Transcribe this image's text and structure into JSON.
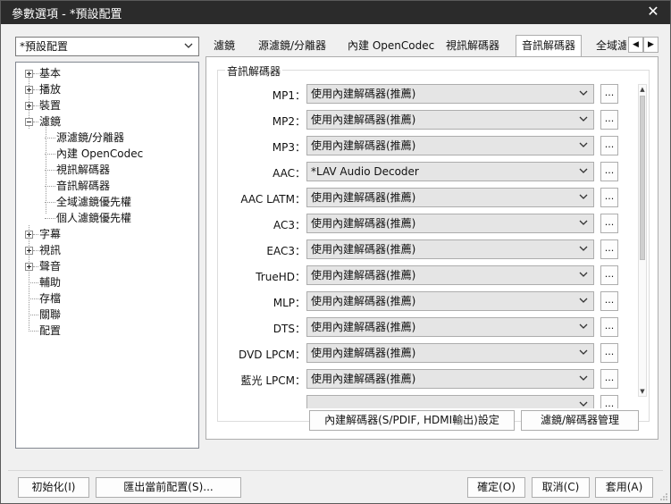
{
  "window": {
    "title": "參數選項 - *預設配置",
    "close_glyph": "✕"
  },
  "profile": {
    "selected": "*預設配置"
  },
  "tree": [
    {
      "label": "基本",
      "expandable": true
    },
    {
      "label": "播放",
      "expandable": true
    },
    {
      "label": "裝置",
      "expandable": true
    },
    {
      "label": "濾鏡",
      "expandable": true,
      "expanded": true,
      "children": [
        "源濾鏡/分離器",
        "內建 OpenCodec",
        "視訊解碼器",
        "音訊解碼器",
        "全域濾鏡優先權",
        "個人濾鏡優先權"
      ]
    },
    {
      "label": "字幕",
      "expandable": true
    },
    {
      "label": "視訊",
      "expandable": true
    },
    {
      "label": "聲音",
      "expandable": true
    },
    {
      "label": "輔助",
      "expandable": false
    },
    {
      "label": "存檔",
      "expandable": false
    },
    {
      "label": "關聯",
      "expandable": false
    },
    {
      "label": "配置",
      "expandable": false
    }
  ],
  "tabs": [
    {
      "label": "濾鏡"
    },
    {
      "label": "源濾鏡/分離器"
    },
    {
      "label": "內建 OpenCodec"
    },
    {
      "label": "視訊解碼器"
    },
    {
      "label": "音訊解碼器",
      "active": true
    },
    {
      "label": "全域濾"
    }
  ],
  "tab_scroll": {
    "left": "◀",
    "right": "▶"
  },
  "group": {
    "title": "音訊解碼器"
  },
  "decoders": [
    {
      "label": "MP1：",
      "value": "使用內建解碼器(推薦)"
    },
    {
      "label": "MP2：",
      "value": "使用內建解碼器(推薦)"
    },
    {
      "label": "MP3：",
      "value": "使用內建解碼器(推薦)"
    },
    {
      "label": "AAC：",
      "value": "*LAV Audio Decoder"
    },
    {
      "label": "AAC LATM：",
      "value": "使用內建解碼器(推薦)"
    },
    {
      "label": "AC3：",
      "value": "使用內建解碼器(推薦)"
    },
    {
      "label": "EAC3：",
      "value": "使用內建解碼器(推薦)"
    },
    {
      "label": "TrueHD：",
      "value": "使用內建解碼器(推薦)"
    },
    {
      "label": "MLP：",
      "value": "使用內建解碼器(推薦)"
    },
    {
      "label": "DTS：",
      "value": "使用內建解碼器(推薦)"
    },
    {
      "label": "DVD LPCM：",
      "value": "使用內建解碼器(推薦)"
    },
    {
      "label": "藍光 LPCM：",
      "value": "使用內建解碼器(推薦)"
    },
    {
      "label": "",
      "value": ""
    }
  ],
  "more_label": "...",
  "scroll_up": "▲",
  "scroll_down": "▼",
  "panel_buttons": {
    "builtin_settings": "內建解碼器(S/PDIF, HDMI輸出)設定",
    "manage": "濾鏡/解碼器管理"
  },
  "footer": {
    "reset": "初始化(I)",
    "export": "匯出當前配置(S)...",
    "ok": "確定(O)",
    "cancel": "取消(C)",
    "apply": "套用(A)"
  }
}
